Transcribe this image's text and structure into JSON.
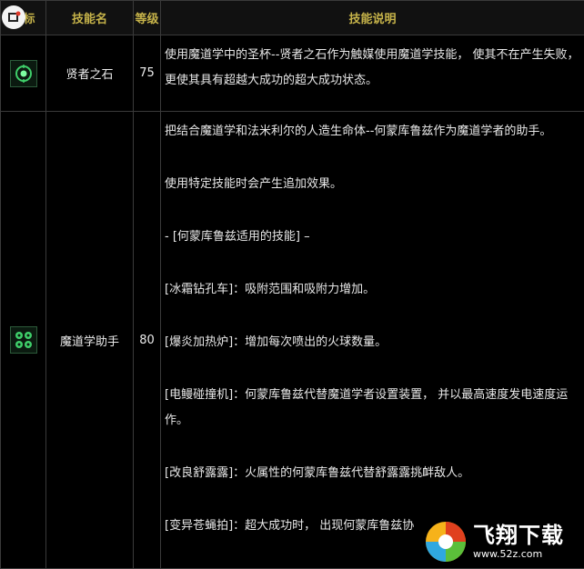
{
  "header": {
    "icon_col": "图标",
    "name_col": "技能名",
    "level_col": "等级",
    "desc_col": "技能说明"
  },
  "rows": [
    {
      "icon": "gem-icon",
      "name": "贤者之石",
      "level": "75",
      "desc": [
        "使用魔道学中的圣杯--贤者之石作为触媒使用魔道学技能， 使其不在产生失败， 更使其具有超越大成功的超大成功状态。"
      ]
    },
    {
      "icon": "homunculus-icon",
      "name": "魔道学助手",
      "level": "80",
      "desc": [
        "把结合魔道学和法米利尔的人造生命体--何蒙库鲁兹作为魔道学者的助手。",
        "使用特定技能时会产生追加效果。",
        "- [何蒙库鲁兹适用的技能] –",
        "[冰霜钻孔车]：吸附范围和吸附力增加。",
        "[爆炎加热炉]：增加每次喷出的火球数量。",
        "[电鳗碰撞机]：何蒙库鲁兹代替魔道学者设置装置， 并以最高速度发电速度运作。",
        "[改良舒露露]：火属性的何蒙库鲁兹代替舒露露挑衅敌人。",
        "[变异苍蝇拍]：超大成功时， 出现何蒙库鲁兹协"
      ]
    }
  ],
  "watermark": {
    "title": "飞翔下载",
    "url": "www.52z.com"
  },
  "colors": {
    "header_text": "#c7b44a",
    "border": "#3a3a3a",
    "icon_green": "#3fcf6a"
  }
}
